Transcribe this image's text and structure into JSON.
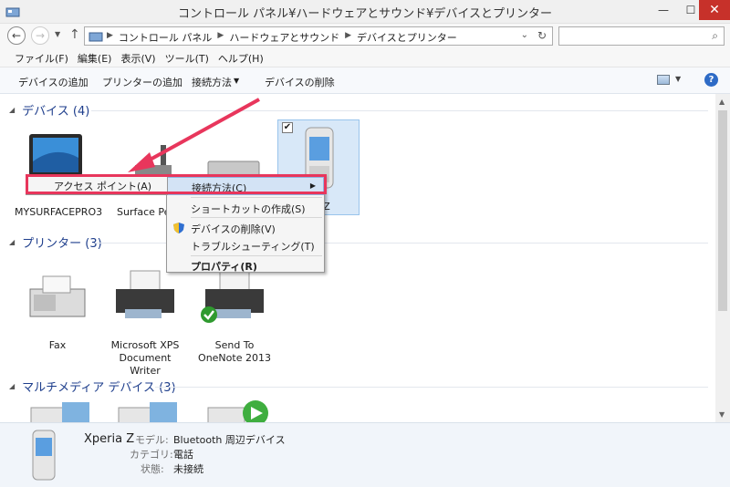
{
  "window": {
    "title": "コントロール パネル¥ハードウェアとサウンド¥デバイスとプリンター",
    "min": "—",
    "max": "☐",
    "close": "✕"
  },
  "address": {
    "breadcrumbs": [
      "コントロール パネル",
      "ハードウェアとサウンド",
      "デバイスとプリンター"
    ],
    "back": "←",
    "forward": "→",
    "up": "↑",
    "refresh": "↻",
    "search_placeholder": ""
  },
  "menu": [
    "ファイル(F)",
    "編集(E)",
    "表示(V)",
    "ツール(T)",
    "ヘルプ(H)"
  ],
  "commands": {
    "add_device": "デバイスの追加",
    "add_printer": "プリンターの追加",
    "connect_using": "接続方法",
    "remove_device": "デバイスの削除",
    "help": "?"
  },
  "groups": {
    "devices": {
      "title": "デバイス (4)",
      "items": [
        "MYSURFACEPRO3",
        "Surface Pe",
        "",
        "ia Z"
      ]
    },
    "printers": {
      "title": "プリンター (3)",
      "items": [
        "Fax",
        "Microsoft XPS Document Writer",
        "Send To OneNote 2013"
      ]
    },
    "multimedia": {
      "title": "マルチメディア デバイス (3)"
    }
  },
  "context_menu": {
    "connect_using": "接続方法(C)",
    "create_shortcut": "ショートカットの作成(S)",
    "remove_device": "デバイスの削除(V)",
    "troubleshoot": "トラブルシューティング(T)",
    "properties": "プロパティ(R)",
    "submenu_access_point": "アクセス ポイント(A)"
  },
  "details": {
    "name": "Xperia Z",
    "model_label": "モデル:",
    "model_value": "Bluetooth 周辺デバイス",
    "category_label": "カテゴリ:",
    "category_value": "電話",
    "status_label": "状態:",
    "status_value": "未接続"
  },
  "colors": {
    "accent": "#1e3e8c",
    "callout": "#e8365c",
    "close": "#c7312a",
    "selection": "#d8e8f8"
  }
}
